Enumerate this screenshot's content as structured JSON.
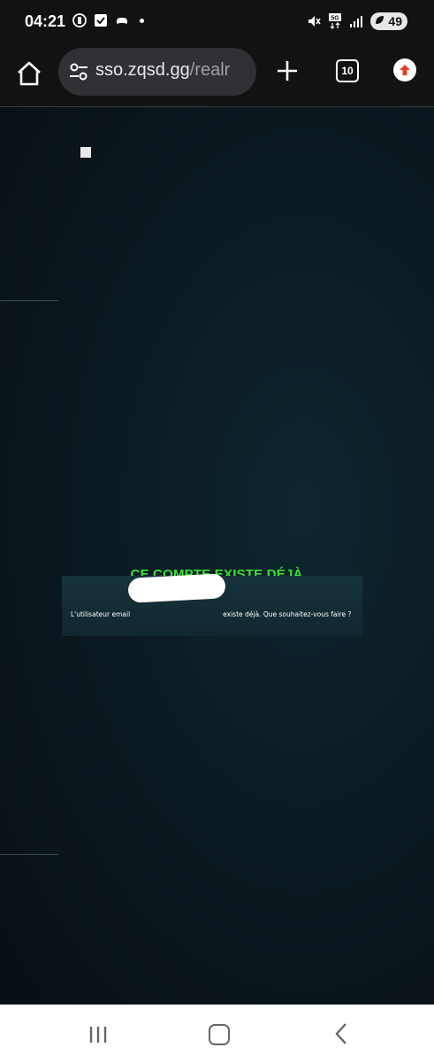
{
  "status_bar": {
    "time": "04:21",
    "battery": "49",
    "network": "5G"
  },
  "browser": {
    "url_host": "sso.zqsd.gg",
    "url_path": "/realr",
    "tab_count": "10",
    "icons": [
      "home-icon",
      "site-settings-icon",
      "new-tab-plus-icon",
      "tab-switcher-icon",
      "update-icon"
    ]
  },
  "page": {
    "modal_title": "CE COMPTE EXISTE DÉJÀ",
    "message_prefix": "L'utilisateur email",
    "message_suffix": "existe déjà. Que souhaitez-vous faire ?"
  },
  "nav_bar": {
    "icons": [
      "recent-apps-icon",
      "home-nav-icon",
      "back-icon"
    ]
  },
  "colors": {
    "accent_green": "#3be03b",
    "background": "#0b1a21"
  }
}
